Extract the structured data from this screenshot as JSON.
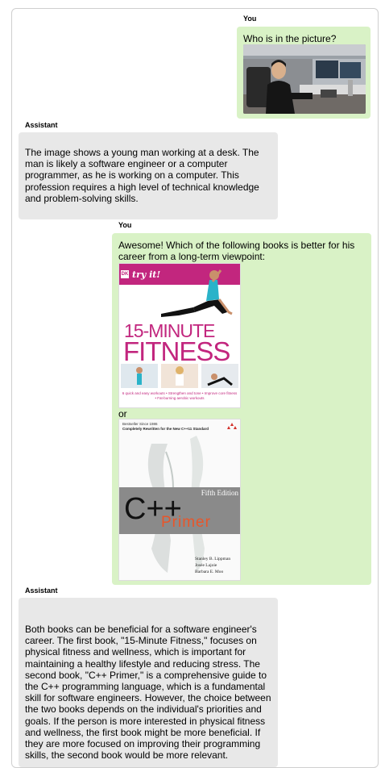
{
  "messages": [
    {
      "speaker": "You",
      "text": "Who is in the picture?"
    },
    {
      "speaker": "Assistant",
      "text": "The image shows a young man working at a desk. The man is likely a software engineer or a computer programmer, as he is working on a computer. This profession requires a high level of technical knowledge and problem-solving skills."
    },
    {
      "speaker": "You",
      "text": "Awesome! Which of the following books is better for his career from a long-term viewpoint:",
      "separator": "or"
    },
    {
      "speaker": "Assistant",
      "text": "Both books can be beneficial for a software engineer's career. The first book, \"15-Minute Fitness,\" focuses on physical fitness and wellness, which is important for maintaining a healthy lifestyle and reducing stress. The second book, \"C++ Primer,\" is a comprehensive guide to the C++ programming language, which is a fundamental skill for software engineers. However, the choice between the two books depends on the individual's priorities and goals. If the person is more interested in physical fitness and wellness, the first book might be more beneficial. If they are more focused on improving their programming skills, the second book would be more relevant."
    }
  ],
  "book1": {
    "brand": "DK",
    "banner": "try it!",
    "title_top": "15-MINUTE",
    "title_bottom": "FITNESS",
    "tagline": "6 quick and easy workouts • Strengthen and tone • Improve core fitness • Fat-burning aerobic workouts"
  },
  "book2": {
    "top_line1": "Bestseller Since 1986",
    "top_line2": "Completely Rewritten for the New C++11 Standard",
    "edition": "Fifth Edition",
    "title_main": "C++",
    "title_sub": "Primer",
    "authors": [
      "Stanley B. Lippman",
      "Josée Lajoie",
      "Barbara E. Moo"
    ]
  },
  "colors": {
    "user_bubble": "#d9f2c6",
    "assistant_bubble": "#e8e8e8",
    "fitness_magenta": "#c2267e",
    "primer_orange": "#e8562a"
  }
}
